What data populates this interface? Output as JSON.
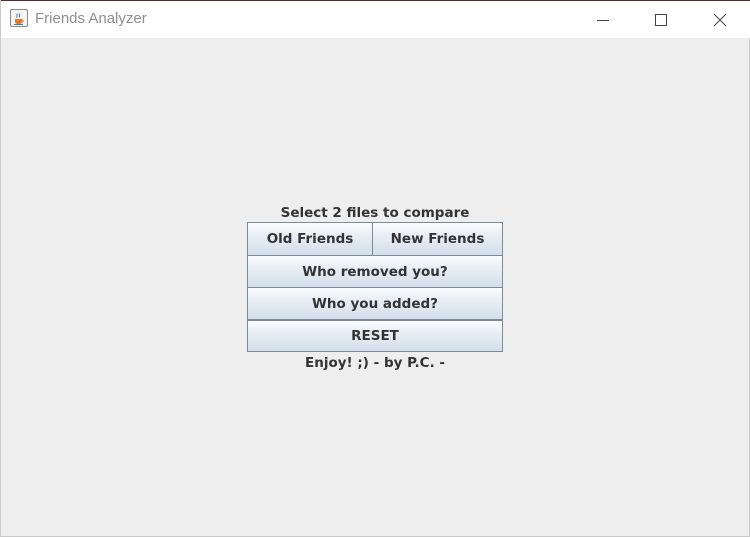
{
  "window": {
    "title": "Friends Analyzer",
    "app_icon": "java-cup-icon",
    "controls": [
      "minimize-icon",
      "maximize-icon",
      "close-icon"
    ]
  },
  "main": {
    "heading": "Select 2 files to compare",
    "buttons": {
      "old_friends": "Old Friends",
      "new_friends": "New Friends",
      "who_removed": "Who removed you?",
      "who_added": "Who you added?",
      "reset": "RESET"
    },
    "footer": "Enjoy! ;) - by P.C. -"
  },
  "colors": {
    "background": "#eeeeee",
    "button_top": "#fbfcfd",
    "button_bottom": "#d3dfeb",
    "button_border": "#7a8a99",
    "text": "#333333"
  }
}
